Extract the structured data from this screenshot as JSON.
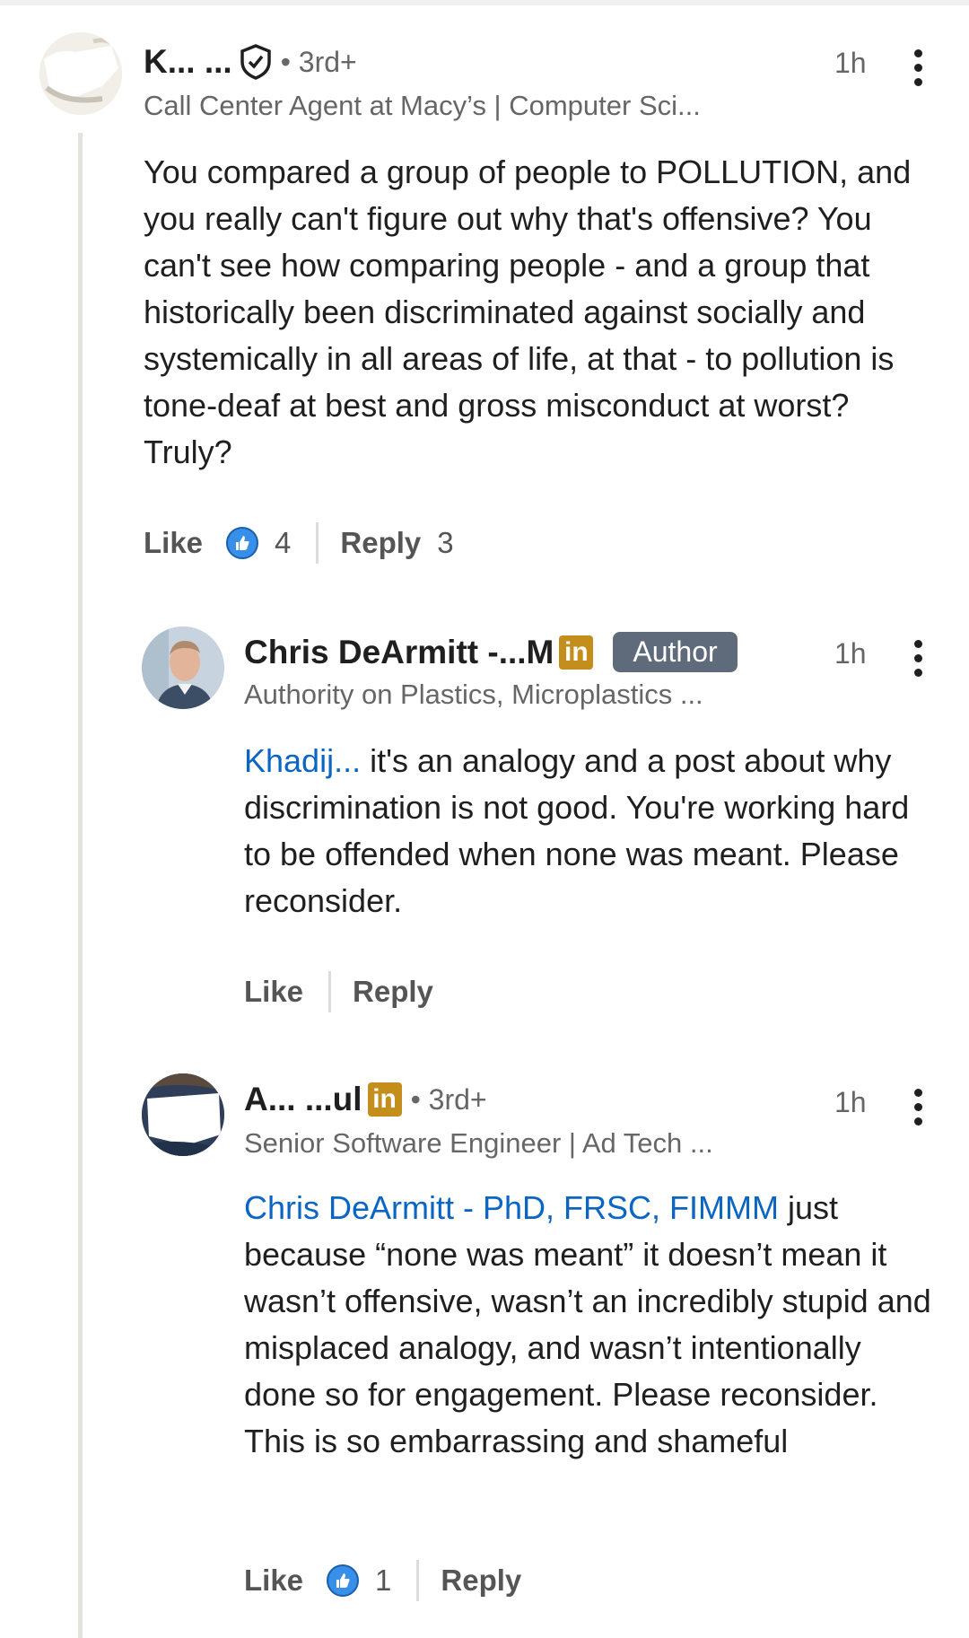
{
  "comments": [
    {
      "name": "K... ...",
      "degree": "• 3rd+",
      "headline": "Call Center Agent at Macy’s | Computer Sci...",
      "time": "1h",
      "body": "You compared a group of people to POLLUTION, and you really can't figure out why that's offensive? You can't see how comparing people - and a group that historically been discriminated against socially and systemically in all areas of life, at that - to pollution is tone-deaf at best and gross misconduct at worst? Truly?",
      "like_label": "Like",
      "like_count": "4",
      "reply_label": "Reply",
      "reply_count": "3"
    },
    {
      "name": "Chris DeArmitt -...M",
      "author_badge": "Author",
      "headline": "Authority on Plastics, Microplastics ...",
      "time": "1h",
      "mention": "Khadij...",
      "body": "it's an analogy and a post about why discrimination is not good. You're working hard to be offended when none was meant. Please reconsider.",
      "like_label": "Like",
      "reply_label": "Reply"
    },
    {
      "name": "A... ...ul",
      "degree": "• 3rd+",
      "headline": "Senior Software Engineer | Ad Tech ...",
      "time": "1h",
      "mention": "Chris DeArmitt - PhD, FRSC, FIMMM",
      "body": "just because “none was meant” it doesn’t mean it wasn’t offensive, wasn’t an incredibly stupid and misplaced analogy, and wasn’t intentionally done so for engagement. Please reconsider. This is so embarrassing and shameful",
      "like_label": "Like",
      "like_count": "1",
      "reply_label": "Reply"
    }
  ],
  "icons": {
    "verified": "shield-check-icon",
    "linkedin": "in",
    "reaction": "thumbs-up-icon",
    "more": "more-vertical-icon"
  },
  "colors": {
    "mention": "#0a66c2",
    "reaction": "#378fe9",
    "linkedin_badge": "#c38e1c",
    "author_badge": "#5f6b7a"
  }
}
